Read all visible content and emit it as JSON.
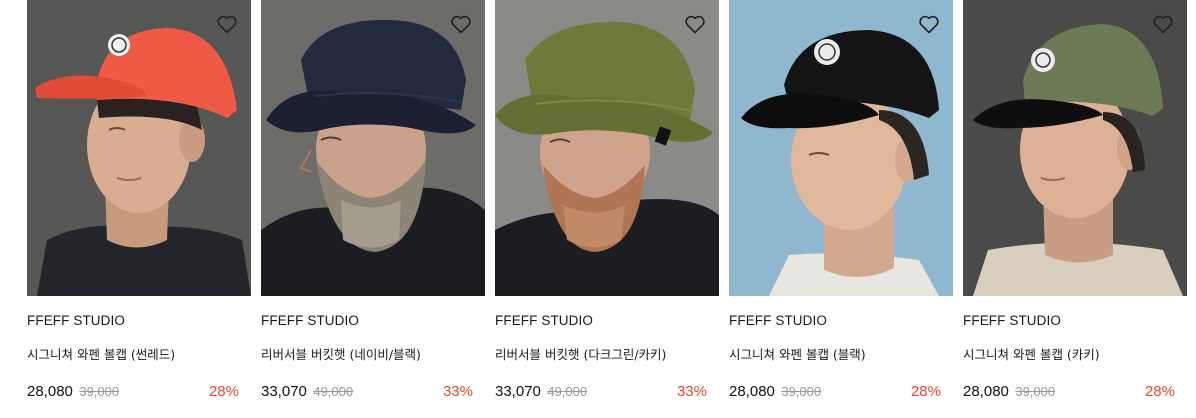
{
  "products": [
    {
      "brand": "FFEFF STUDIO",
      "name": "시그니쳐 와펜 볼캡 (썬레드)",
      "price": "28,080",
      "original_price": "39,000",
      "discount": "28%",
      "photo": {
        "background": "#5b5b59",
        "hat_color": "#ee5a45",
        "hat_style": "ball-cap",
        "beard": false,
        "shirt": "#23252a"
      }
    },
    {
      "brand": "FFEFF STUDIO",
      "name": "리버서블 버킷햇 (네이비/블랙)",
      "price": "33,070",
      "original_price": "49,000",
      "discount": "33%",
      "photo": {
        "background": "#6d6c69",
        "hat_color": "#232a3e",
        "hat_style": "bucket",
        "beard": true,
        "shirt": "#1c1d20"
      }
    },
    {
      "brand": "FFEFF STUDIO",
      "name": "리버서블 버킷햇 (다크그린/카키)",
      "price": "33,070",
      "original_price": "49,000",
      "discount": "33%",
      "photo": {
        "background": "#8b8a86",
        "hat_color": "#6e7a3b",
        "hat_style": "bucket",
        "beard": true,
        "shirt": "#1c1d20"
      }
    },
    {
      "brand": "FFEFF STUDIO",
      "name": "시그니쳐 와펜 볼캡 (블랙)",
      "price": "28,080",
      "original_price": "39,000",
      "discount": "28%",
      "photo": {
        "background": "#8fb8cf",
        "hat_color": "#141414",
        "hat_style": "ball-cap",
        "beard": false,
        "shirt": "#e8e6e1"
      }
    },
    {
      "brand": "FFEFF STUDIO",
      "name": "시그니쳐 와펜 볼캡 (카키)",
      "price": "28,080",
      "original_price": "39,000",
      "discount": "28%",
      "photo": {
        "background": "#4a4a48",
        "hat_color": "#6c7a55",
        "hat_style": "ball-cap",
        "beard": false,
        "shirt": "#d8cfbf"
      }
    }
  ],
  "icons": {
    "wishlist": "heart-outline-icon"
  },
  "colors": {
    "discount": "#e8492b",
    "original_price": "#999999",
    "text": "#1a1a1a"
  }
}
